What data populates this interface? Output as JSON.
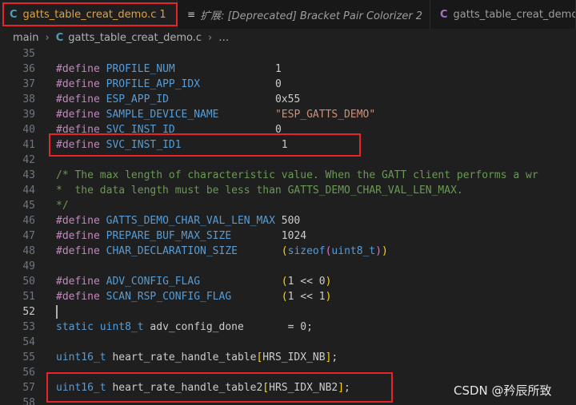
{
  "tabs": [
    {
      "name": "gatts_table_creat_demo.c",
      "badge": "1",
      "icon": "C",
      "modified": true
    },
    {
      "name": "扩展: [Deprecated] Bracket Pair Colorizer 2",
      "icon": "extension-file-icon"
    },
    {
      "name": "gatts_table_creat_demo.h",
      "icon": "C"
    }
  ],
  "breadcrumb": {
    "folder": "main",
    "file": "gatts_table_creat_demo.c",
    "more": "…",
    "icon": "C"
  },
  "editor": {
    "lines": [
      {
        "n": "35",
        "tokens": []
      },
      {
        "n": "36",
        "tokens": [
          {
            "t": "#define",
            "c": "tk-dir"
          },
          {
            "t": " "
          },
          {
            "t": "PROFILE_NUM",
            "c": "tk-mac"
          },
          {
            "t": "                1"
          }
        ]
      },
      {
        "n": "37",
        "tokens": [
          {
            "t": "#define",
            "c": "tk-dir"
          },
          {
            "t": " "
          },
          {
            "t": "PROFILE_APP_IDX",
            "c": "tk-mac"
          },
          {
            "t": "            0"
          }
        ]
      },
      {
        "n": "38",
        "tokens": [
          {
            "t": "#define",
            "c": "tk-dir"
          },
          {
            "t": " "
          },
          {
            "t": "ESP_APP_ID",
            "c": "tk-mac"
          },
          {
            "t": "                 0x55"
          }
        ]
      },
      {
        "n": "39",
        "tokens": [
          {
            "t": "#define",
            "c": "tk-dir"
          },
          {
            "t": " "
          },
          {
            "t": "SAMPLE_DEVICE_NAME",
            "c": "tk-mac"
          },
          {
            "t": "         "
          },
          {
            "t": "\"ESP_GATTS_DEMO\"",
            "c": "tk-str"
          }
        ]
      },
      {
        "n": "40",
        "tokens": [
          {
            "t": "#define",
            "c": "tk-dir"
          },
          {
            "t": " "
          },
          {
            "t": "SVC_INST_ID",
            "c": "tk-mac"
          },
          {
            "t": "                0"
          }
        ]
      },
      {
        "n": "41",
        "tokens": [
          {
            "t": "#define",
            "c": "tk-dir"
          },
          {
            "t": " "
          },
          {
            "t": "SVC_INST_ID1",
            "c": "tk-mac"
          },
          {
            "t": "                1"
          }
        ]
      },
      {
        "n": "42",
        "tokens": []
      },
      {
        "n": "43",
        "tokens": [
          {
            "t": "/* The max length of characteristic value. When the GATT client performs a wr",
            "c": "tk-com"
          }
        ]
      },
      {
        "n": "44",
        "tokens": [
          {
            "t": "*  the data length must be less than GATTS_DEMO_CHAR_VAL_LEN_MAX.",
            "c": "tk-com"
          }
        ]
      },
      {
        "n": "45",
        "tokens": [
          {
            "t": "*/",
            "c": "tk-com"
          }
        ]
      },
      {
        "n": "46",
        "tokens": [
          {
            "t": "#define",
            "c": "tk-dir"
          },
          {
            "t": " "
          },
          {
            "t": "GATTS_DEMO_CHAR_VAL_LEN_MAX",
            "c": "tk-mac"
          },
          {
            "t": " 500"
          }
        ]
      },
      {
        "n": "47",
        "tokens": [
          {
            "t": "#define",
            "c": "tk-dir"
          },
          {
            "t": " "
          },
          {
            "t": "PREPARE_BUF_MAX_SIZE",
            "c": "tk-mac"
          },
          {
            "t": "        1024"
          }
        ]
      },
      {
        "n": "48",
        "tokens": [
          {
            "t": "#define",
            "c": "tk-dir"
          },
          {
            "t": " "
          },
          {
            "t": "CHAR_DECLARATION_SIZE",
            "c": "tk-mac"
          },
          {
            "t": "       "
          },
          {
            "t": "(",
            "c": "tk-br"
          },
          {
            "t": "sizeof",
            "c": "tk-kw"
          },
          {
            "t": "(",
            "c": "tk-br2"
          },
          {
            "t": "uint8_t",
            "c": "tk-kw"
          },
          {
            "t": ")",
            "c": "tk-br2"
          },
          {
            "t": ")",
            "c": "tk-br"
          }
        ]
      },
      {
        "n": "49",
        "tokens": []
      },
      {
        "n": "50",
        "tokens": [
          {
            "t": "#define",
            "c": "tk-dir"
          },
          {
            "t": " "
          },
          {
            "t": "ADV_CONFIG_FLAG",
            "c": "tk-mac"
          },
          {
            "t": "             "
          },
          {
            "t": "(",
            "c": "tk-br"
          },
          {
            "t": "1 << 0"
          },
          {
            "t": ")",
            "c": "tk-br"
          }
        ]
      },
      {
        "n": "51",
        "tokens": [
          {
            "t": "#define",
            "c": "tk-dir"
          },
          {
            "t": " "
          },
          {
            "t": "SCAN_RSP_CONFIG_FLAG",
            "c": "tk-mac"
          },
          {
            "t": "        "
          },
          {
            "t": "(",
            "c": "tk-br"
          },
          {
            "t": "1 << 1"
          },
          {
            "t": ")",
            "c": "tk-br"
          }
        ]
      },
      {
        "n": "52",
        "tokens": [],
        "cursor": true
      },
      {
        "n": "53",
        "tokens": [
          {
            "t": "static",
            "c": "tk-kw"
          },
          {
            "t": " "
          },
          {
            "t": "uint8_t",
            "c": "tk-kw"
          },
          {
            "t": " adv_config_done       = 0;"
          }
        ]
      },
      {
        "n": "54",
        "tokens": []
      },
      {
        "n": "55",
        "tokens": [
          {
            "t": "uint16_t",
            "c": "tk-kw"
          },
          {
            "t": " heart_rate_handle_table"
          },
          {
            "t": "[",
            "c": "tk-br"
          },
          {
            "t": "HRS_IDX_NB"
          },
          {
            "t": "]",
            "c": "tk-br"
          },
          {
            "t": ";"
          }
        ]
      },
      {
        "n": "56",
        "tokens": []
      },
      {
        "n": "57",
        "tokens": [
          {
            "t": "uint16_t",
            "c": "tk-kw"
          },
          {
            "t": " heart_rate_handle_table2"
          },
          {
            "t": "[",
            "c": "tk-br"
          },
          {
            "t": "HRS_IDX_NB2"
          },
          {
            "t": "]",
            "c": "tk-br"
          },
          {
            "t": ";"
          }
        ]
      },
      {
        "n": "58",
        "tokens": []
      }
    ]
  },
  "watermark": "CSDN @矜辰所致",
  "colors": {
    "highlight": "#e5252a",
    "active_tab_text": "#e2a13a"
  }
}
